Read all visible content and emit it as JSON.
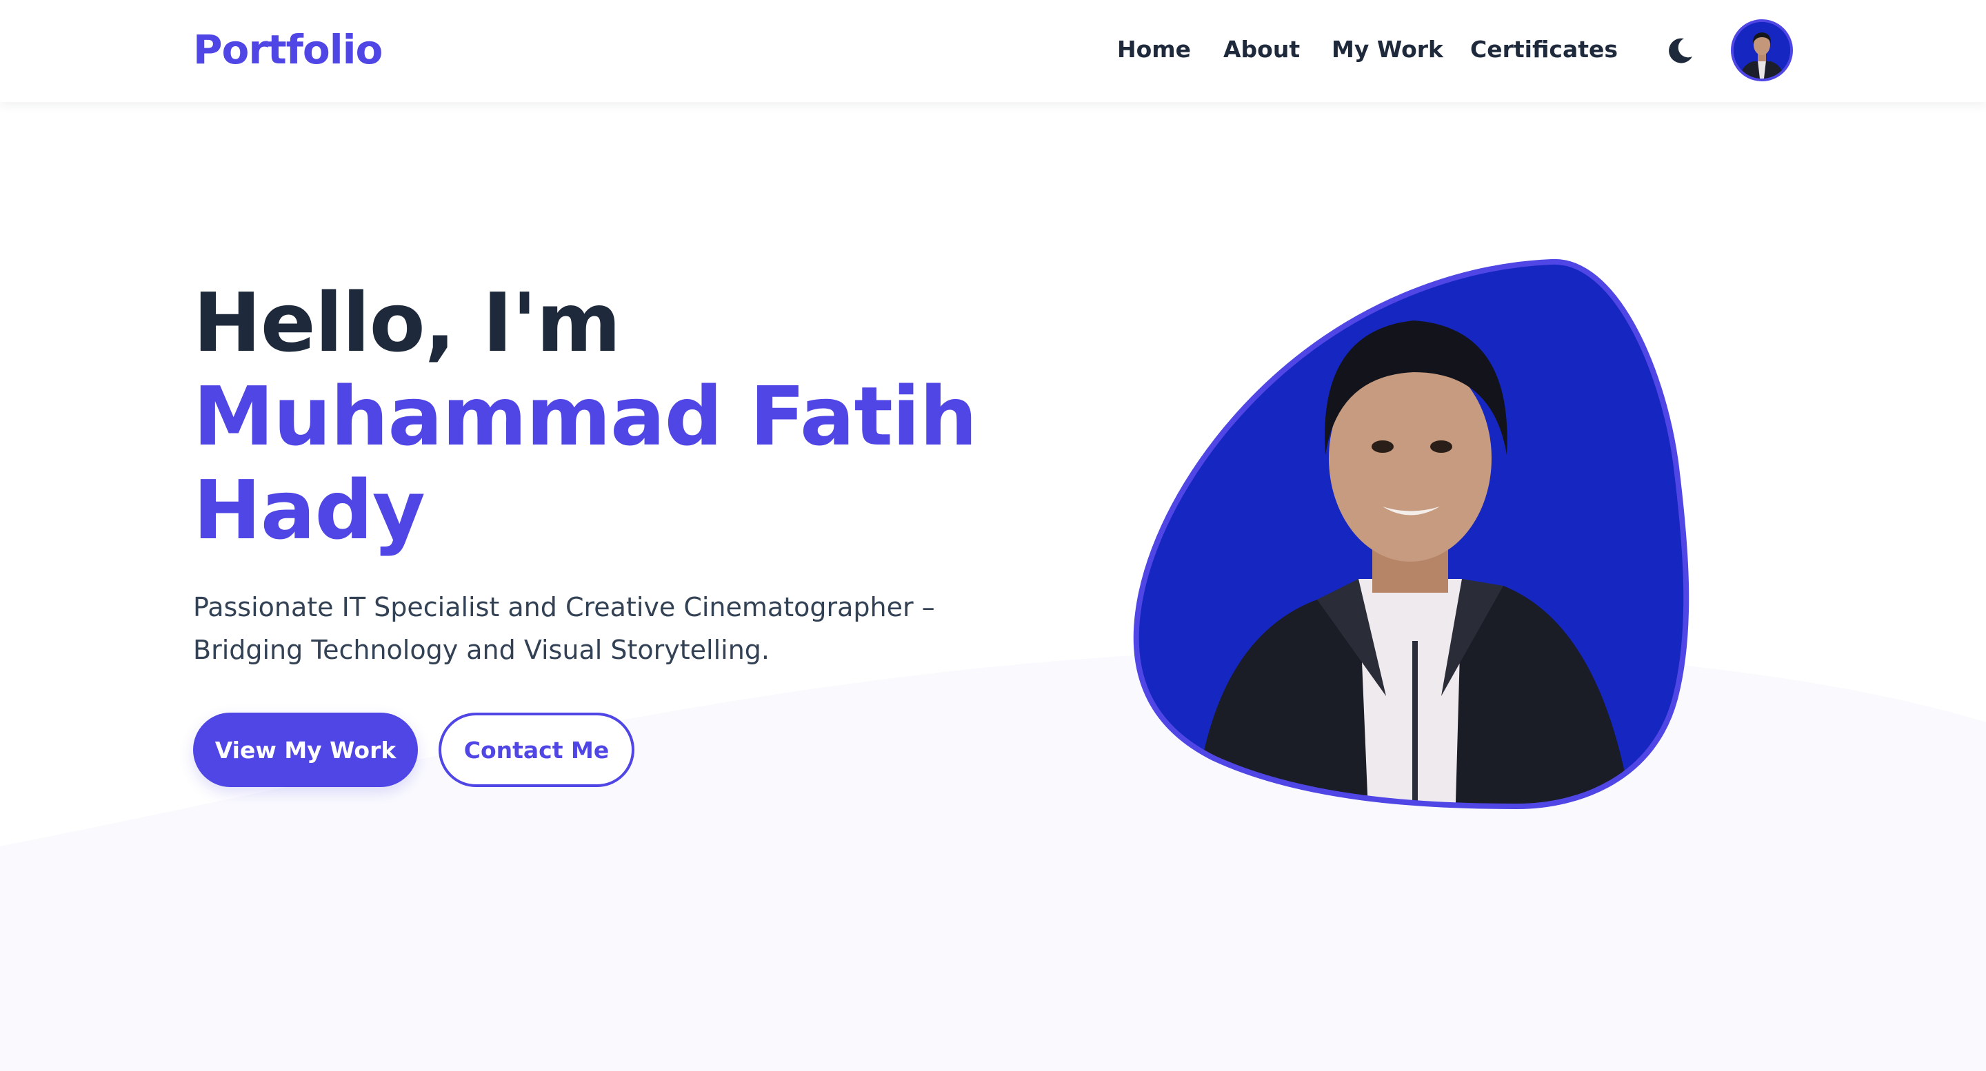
{
  "navbar": {
    "brand": "Portfolio",
    "links": [
      "Home",
      "About",
      "My Work",
      "Certificates"
    ],
    "theme_icon": "moon-icon",
    "avatar_icon": "profile-avatar"
  },
  "hero": {
    "greeting": "Hello, I'm",
    "name_line1": "Muhammad Fatih",
    "name_line2": "Hady",
    "subtitle_line1": "Passionate IT Specialist and Creative Cinematographer –",
    "subtitle_line2": "Bridging Technology and Visual Storytelling.",
    "primary_button": "View My Work",
    "secondary_button": "Contact Me",
    "portrait": "profile-portrait"
  },
  "colors": {
    "accent": "#4f46e5",
    "heading": "#1e293b",
    "text": "#334155",
    "photo_background": "#1626c0",
    "page_background": "#ffffff",
    "wave": "#fafafe"
  }
}
